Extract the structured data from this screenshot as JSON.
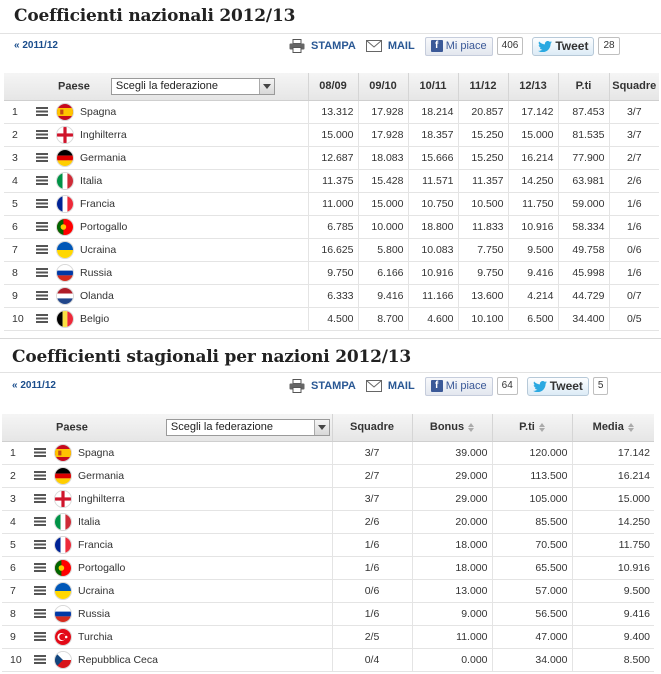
{
  "colors": {
    "link": "#1a4d8c",
    "share_text": "#2a5894",
    "facebook": "#3b5998"
  },
  "national": {
    "title": "Coefficienti nazionali 2012/13",
    "prev_link": "« 2011/12",
    "share": {
      "print": "STAMPA",
      "mail": "MAIL",
      "like": "Mi piace",
      "like_count": "406",
      "tweet": "Tweet",
      "tweet_count": "28"
    },
    "headers": {
      "paese": "Paese",
      "select": "Scegli la federazione",
      "y1": "08/09",
      "y2": "09/10",
      "y3": "10/11",
      "y4": "11/12",
      "y5": "12/13",
      "pti": "P.ti",
      "squadre": "Squadre"
    },
    "rows": [
      {
        "rank": "1",
        "flag": "esp",
        "name": "Spagna",
        "c": [
          "13.312",
          "17.928",
          "18.214",
          "20.857",
          "17.142"
        ],
        "pti": "87.453",
        "squadre": "3/7"
      },
      {
        "rank": "2",
        "flag": "eng",
        "name": "Inghilterra",
        "c": [
          "15.000",
          "17.928",
          "18.357",
          "15.250",
          "15.000"
        ],
        "pti": "81.535",
        "squadre": "3/7"
      },
      {
        "rank": "3",
        "flag": "ger",
        "name": "Germania",
        "c": [
          "12.687",
          "18.083",
          "15.666",
          "15.250",
          "16.214"
        ],
        "pti": "77.900",
        "squadre": "2/7"
      },
      {
        "rank": "4",
        "flag": "ita",
        "name": "Italia",
        "c": [
          "11.375",
          "15.428",
          "11.571",
          "11.357",
          "14.250"
        ],
        "pti": "63.981",
        "squadre": "2/6"
      },
      {
        "rank": "5",
        "flag": "fra",
        "name": "Francia",
        "c": [
          "11.000",
          "15.000",
          "10.750",
          "10.500",
          "11.750"
        ],
        "pti": "59.000",
        "squadre": "1/6"
      },
      {
        "rank": "6",
        "flag": "por",
        "name": "Portogallo",
        "c": [
          "6.785",
          "10.000",
          "18.800",
          "11.833",
          "10.916"
        ],
        "pti": "58.334",
        "squadre": "1/6"
      },
      {
        "rank": "7",
        "flag": "ukr",
        "name": "Ucraina",
        "c": [
          "16.625",
          "5.800",
          "10.083",
          "7.750",
          "9.500"
        ],
        "pti": "49.758",
        "squadre": "0/6"
      },
      {
        "rank": "8",
        "flag": "rus",
        "name": "Russia",
        "c": [
          "9.750",
          "6.166",
          "10.916",
          "9.750",
          "9.416"
        ],
        "pti": "45.998",
        "squadre": "1/6"
      },
      {
        "rank": "9",
        "flag": "ned",
        "name": "Olanda",
        "c": [
          "6.333",
          "9.416",
          "11.166",
          "13.600",
          "4.214"
        ],
        "pti": "44.729",
        "squadre": "0/7"
      },
      {
        "rank": "10",
        "flag": "bel",
        "name": "Belgio",
        "c": [
          "4.500",
          "8.700",
          "4.600",
          "10.100",
          "6.500"
        ],
        "pti": "34.400",
        "squadre": "0/5"
      }
    ]
  },
  "seasonal": {
    "title": "Coefficienti stagionali per nazioni 2012/13",
    "prev_link": "« 2011/12",
    "share": {
      "print": "STAMPA",
      "mail": "MAIL",
      "like": "Mi piace",
      "like_count": "64",
      "tweet": "Tweet",
      "tweet_count": "5"
    },
    "headers": {
      "paese": "Paese",
      "select": "Scegli la federazione",
      "squadre": "Squadre",
      "bonus": "Bonus",
      "pti": "P.ti",
      "media": "Media"
    },
    "rows": [
      {
        "rank": "1",
        "flag": "esp",
        "name": "Spagna",
        "squadre": "3/7",
        "bonus": "39.000",
        "pti": "120.000",
        "media": "17.142"
      },
      {
        "rank": "2",
        "flag": "ger",
        "name": "Germania",
        "squadre": "2/7",
        "bonus": "29.000",
        "pti": "113.500",
        "media": "16.214"
      },
      {
        "rank": "3",
        "flag": "eng",
        "name": "Inghilterra",
        "squadre": "3/7",
        "bonus": "29.000",
        "pti": "105.000",
        "media": "15.000"
      },
      {
        "rank": "4",
        "flag": "ita",
        "name": "Italia",
        "squadre": "2/6",
        "bonus": "20.000",
        "pti": "85.500",
        "media": "14.250"
      },
      {
        "rank": "5",
        "flag": "fra",
        "name": "Francia",
        "squadre": "1/6",
        "bonus": "18.000",
        "pti": "70.500",
        "media": "11.750"
      },
      {
        "rank": "6",
        "flag": "por",
        "name": "Portogallo",
        "squadre": "1/6",
        "bonus": "18.000",
        "pti": "65.500",
        "media": "10.916"
      },
      {
        "rank": "7",
        "flag": "ukr",
        "name": "Ucraina",
        "squadre": "0/6",
        "bonus": "13.000",
        "pti": "57.000",
        "media": "9.500"
      },
      {
        "rank": "8",
        "flag": "rus",
        "name": "Russia",
        "squadre": "1/6",
        "bonus": "9.000",
        "pti": "56.500",
        "media": "9.416"
      },
      {
        "rank": "9",
        "flag": "tur",
        "name": "Turchia",
        "squadre": "2/5",
        "bonus": "11.000",
        "pti": "47.000",
        "media": "9.400"
      },
      {
        "rank": "10",
        "flag": "cze",
        "name": "Repubblica Ceca",
        "squadre": "0/4",
        "bonus": "0.000",
        "pti": "34.000",
        "media": "8.500"
      }
    ]
  }
}
